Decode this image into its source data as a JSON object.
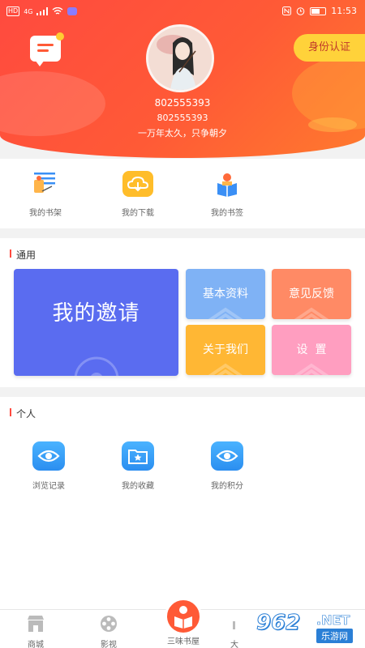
{
  "status_bar": {
    "network_hd": "HD",
    "network_gen": "4G",
    "time": "11:53"
  },
  "header": {
    "user_id": "802555393",
    "user_id_sub": "802555393",
    "motto": "一万年太久，只争朝夕",
    "verify_label": "身份认证"
  },
  "quick_actions": [
    {
      "label": "我的书架",
      "icon": "bookshelf-icon"
    },
    {
      "label": "我的下载",
      "icon": "cloud-download-icon"
    },
    {
      "label": "我的书签",
      "icon": "bookmark-reader-icon"
    }
  ],
  "general": {
    "title": "通用",
    "tiles": {
      "invite": "我的邀请",
      "basic_info": "基本资料",
      "feedback": "意见反馈",
      "about_us": "关于我们",
      "settings": "设  置"
    },
    "colors": {
      "invite": "#5a6cf0",
      "basic_info": "#7fb2f5",
      "feedback": "#ff8a65",
      "about_us": "#ffb734",
      "settings": "#ff9ec0"
    }
  },
  "personal": {
    "title": "个人",
    "items": [
      {
        "label": "浏览记录",
        "icon": "eye-icon"
      },
      {
        "label": "我的收藏",
        "icon": "star-folder-icon"
      },
      {
        "label": "我的积分",
        "icon": "eye-icon"
      }
    ]
  },
  "tabbar": {
    "tabs": [
      {
        "label": "商城",
        "icon": "store-icon"
      },
      {
        "label": "影视",
        "icon": "film-reel-icon"
      },
      {
        "label": "三味书屋",
        "icon": "reader-icon"
      },
      {
        "label": "大",
        "icon": "bar-icon"
      }
    ]
  },
  "watermark": {
    "number": "962",
    "suffix": ".NET",
    "site": "乐游网"
  },
  "colors": {
    "brand": "#ff4a3f",
    "accent_yellow": "#ffd23a"
  }
}
